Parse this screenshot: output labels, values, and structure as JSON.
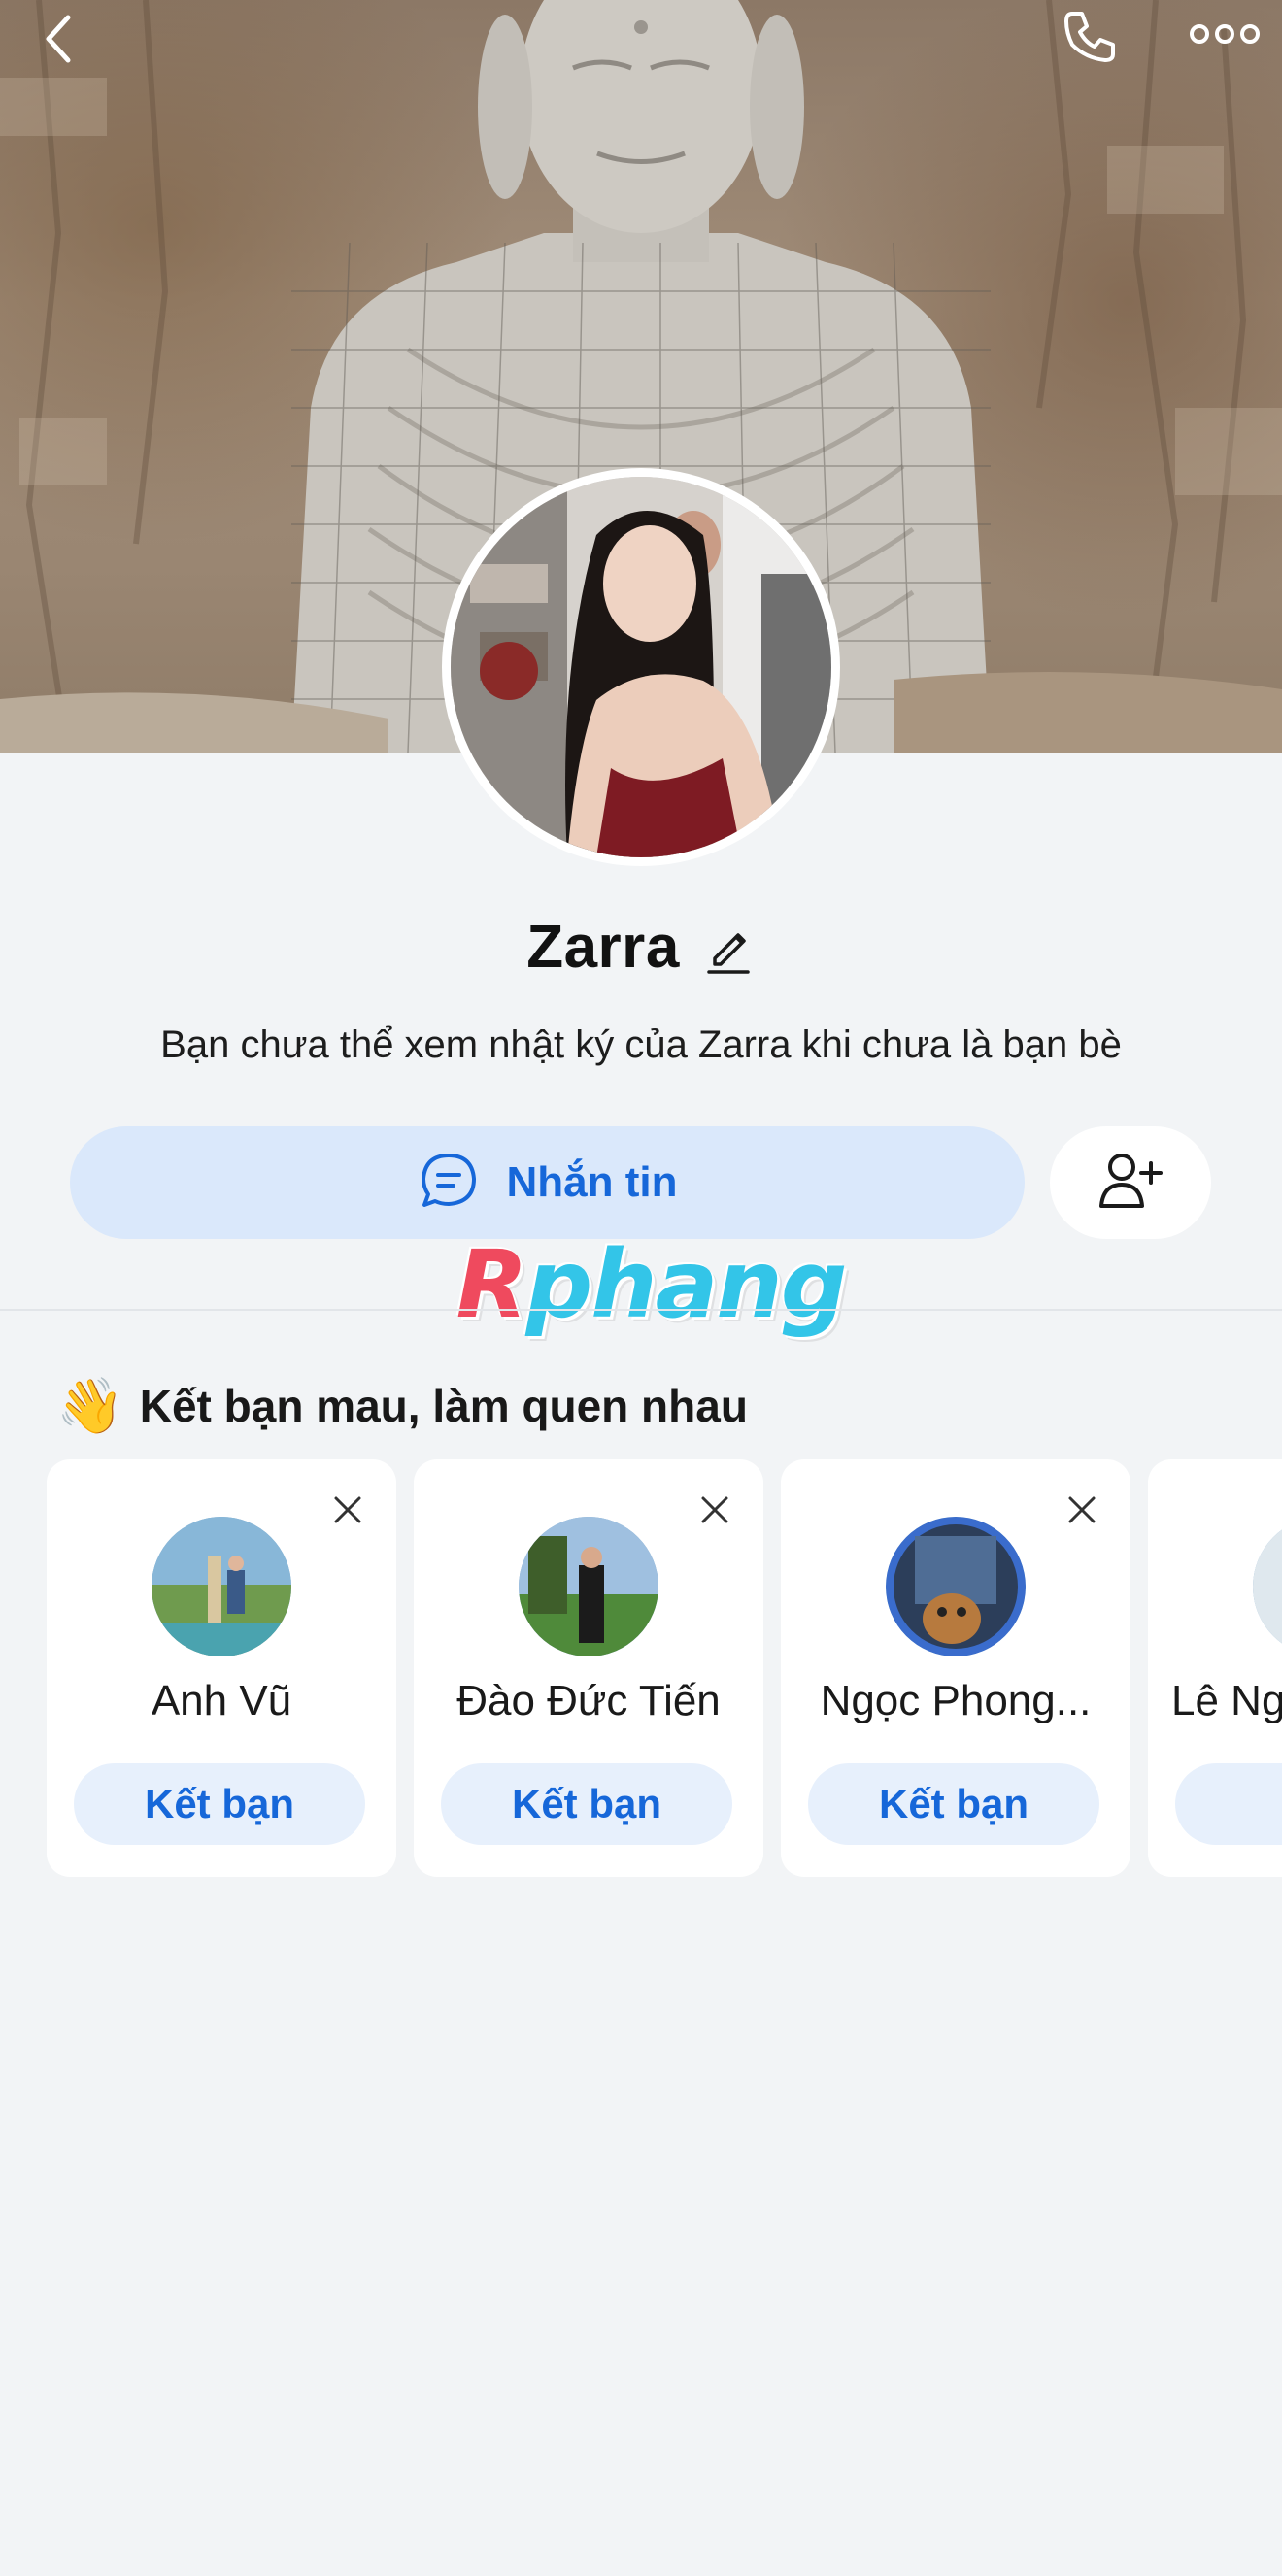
{
  "profile": {
    "name": "Zarra",
    "notice": "Bạn chưa thể xem nhật ký của Zarra khi chưa là bạn bè"
  },
  "actions": {
    "message_label": "Nhắn tin"
  },
  "watermark": {
    "first": "R",
    "rest": "phang"
  },
  "suggestions": {
    "emoji": "👋",
    "title": "Kết bạn mau, làm quen nhau",
    "items": [
      {
        "name": "Anh Vũ",
        "button": "Kết bạn"
      },
      {
        "name": "Đào Đức Tiến",
        "button": "Kết bạn"
      },
      {
        "name": "Ngọc Phong...",
        "button": "Kết bạn"
      },
      {
        "name": "Lê Ng",
        "button": "Kế"
      }
    ]
  },
  "icons": {
    "back": "chevron-left-icon",
    "call": "phone-icon",
    "more": "more-horizontal-icon",
    "edit": "pencil-icon",
    "message": "chat-bubble-icon",
    "add_friend": "user-plus-icon",
    "dismiss": "close-icon"
  },
  "colors": {
    "accent": "#1667d9",
    "primary_button_bg": "#dae8fb",
    "card_button_bg": "#e7f0fc",
    "page_bg": "#f2f4f6"
  }
}
